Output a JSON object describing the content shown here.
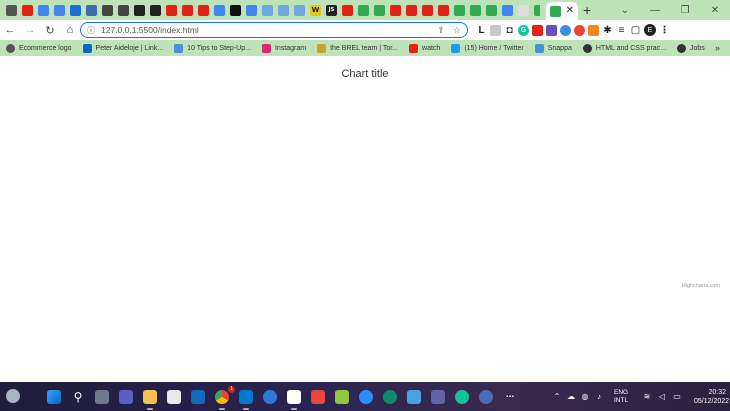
{
  "browser": {
    "tab_strip_favicons": [
      {
        "icon": "chrome-icon",
        "color": "#555555"
      },
      {
        "icon": "youtube-icon",
        "color": "#e62117"
      },
      {
        "icon": "docs-icon",
        "color": "#4285f4"
      },
      {
        "icon": "docs-icon",
        "color": "#4285f4"
      },
      {
        "icon": "stack-icon",
        "color": "#1d6fd8"
      },
      {
        "icon": "tab-icon",
        "color": "#3a6ea5"
      },
      {
        "icon": "grid-icon",
        "color": "#444444"
      },
      {
        "icon": "grid-icon",
        "color": "#444444"
      },
      {
        "icon": "arrow-icon",
        "color": "#222222"
      },
      {
        "icon": "target-icon",
        "color": "#222222"
      },
      {
        "icon": "opera-icon",
        "color": "#e62117"
      },
      {
        "icon": "youtube-icon",
        "color": "#e62117"
      },
      {
        "icon": "opera-icon",
        "color": "#e62117"
      },
      {
        "icon": "google-icon",
        "color": "#4285f4"
      },
      {
        "icon": "medium-icon",
        "color": "#111111"
      },
      {
        "icon": "google-icon",
        "color": "#4285f4"
      },
      {
        "icon": "drive-icon",
        "color": "#6fa8dc"
      },
      {
        "icon": "drive-icon",
        "color": "#6fa8dc"
      },
      {
        "icon": "drive-icon",
        "color": "#6fa8dc"
      },
      {
        "icon": "w-icon",
        "color": "#e6c619"
      },
      {
        "icon": "js-icon",
        "color": "#222222"
      },
      {
        "icon": "youtube-icon",
        "color": "#e62117"
      },
      {
        "icon": "drive-icon",
        "color": "#34a853"
      },
      {
        "icon": "drive-icon",
        "color": "#34a853"
      },
      {
        "icon": "youtube-icon",
        "color": "#e62117"
      },
      {
        "icon": "youtube-icon",
        "color": "#e62117"
      },
      {
        "icon": "youtube-icon",
        "color": "#e62117"
      },
      {
        "icon": "opera-icon",
        "color": "#e62117"
      },
      {
        "icon": "drive-icon",
        "color": "#34a853"
      },
      {
        "icon": "drive-icon",
        "color": "#34a853"
      },
      {
        "icon": "drive-icon",
        "color": "#34a853"
      },
      {
        "icon": "google-icon",
        "color": "#4285f4"
      },
      {
        "icon": "page-icon",
        "color": "#dddddd"
      },
      {
        "icon": "leaf-icon",
        "color": "#34a853"
      },
      {
        "icon": "leaf-icon",
        "color": "#34a853"
      },
      {
        "icon": "youtube-icon",
        "color": "#e62117"
      },
      {
        "icon": "drive-icon",
        "color": "#34a853"
      },
      {
        "icon": "dev-icon",
        "color": "#111111"
      }
    ],
    "dev_label": "DEV",
    "w_label": "W",
    "js_label": "JS",
    "url": "127.0.0.1:5500/index.html",
    "bookmarks": [
      {
        "label": "Ecommerce logo",
        "color": "#555555"
      },
      {
        "label": "Peter Aideloje | Link...",
        "color": "#0a66c2"
      },
      {
        "label": "10 Tips to Step-Up...",
        "color": "#4a90d9"
      },
      {
        "label": "Instagram",
        "color": "#d62976"
      },
      {
        "label": "the BREL team | Tor...",
        "color": "#c9a227"
      },
      {
        "label": "watch",
        "color": "#e62117"
      },
      {
        "label": "(15) Home / Twitter",
        "color": "#1d9bf0"
      },
      {
        "label": "Snappa",
        "color": "#4a90d9"
      },
      {
        "label": "HTML and CSS prac...",
        "color": "#333333"
      },
      {
        "label": "Jobs",
        "color": "#333333"
      }
    ],
    "profile_initial": "E"
  },
  "chart": {
    "title": "Chart title",
    "credits": "Highcharts.com"
  },
  "chart_data": {
    "type": "line",
    "title": "Chart title",
    "series": [],
    "credits": "Highcharts.com"
  },
  "taskbar": {
    "badge": "1",
    "lang_line1": "ENG",
    "lang_line2": "INTL",
    "time": "20:32",
    "date": "05/12/2022"
  }
}
